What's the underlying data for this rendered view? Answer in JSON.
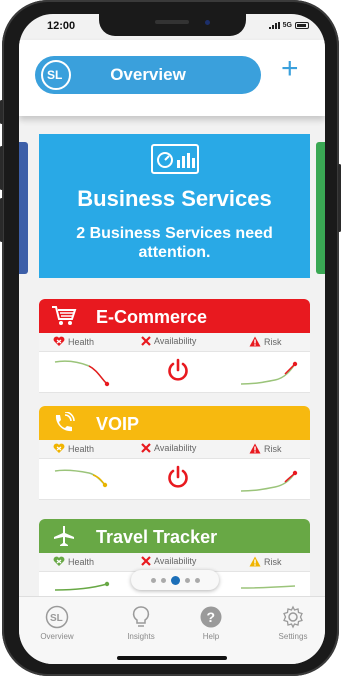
{
  "status_bar": {
    "time": "12:00",
    "network": "5G"
  },
  "header": {
    "title": "Overview",
    "logo_text": "SL",
    "add_label": "+"
  },
  "business_services": {
    "title": "Business Services",
    "subtitle": "2 Business Services need attention.",
    "icon": "dashboard-icon"
  },
  "services": [
    {
      "name": "E-Commerce",
      "color": "#e8191f",
      "icon": "shopping-cart-icon",
      "metrics": {
        "health": "Health",
        "availability": "Availability",
        "risk": "Risk"
      },
      "health_icon": "heart-x-icon",
      "trend_color": "#e8191f"
    },
    {
      "name": "VOIP",
      "color": "#f7b90f",
      "icon": "phone-icon",
      "metrics": {
        "health": "Health",
        "availability": "Availability",
        "risk": "Risk"
      },
      "health_icon": "heart-x-icon",
      "trend_color": "#e8b400"
    },
    {
      "name": "Travel Tracker",
      "color": "#68a845",
      "icon": "airplane-icon",
      "metrics": {
        "health": "Health",
        "availability": "Availability",
        "risk": "Risk"
      },
      "health_icon": "heart-check-icon",
      "trend_color": "#68a845"
    }
  ],
  "pager": {
    "count": 5,
    "active": 2
  },
  "tabs": [
    {
      "label": "Overview",
      "icon": "sl-logo-icon"
    },
    {
      "label": "Insights",
      "icon": "lightbulb-icon"
    },
    {
      "label": "Help",
      "icon": "help-icon"
    },
    {
      "label": "Settings",
      "icon": "gear-icon"
    }
  ],
  "colors": {
    "accent": "#3aa0dc",
    "banner": "#29a9e6"
  }
}
